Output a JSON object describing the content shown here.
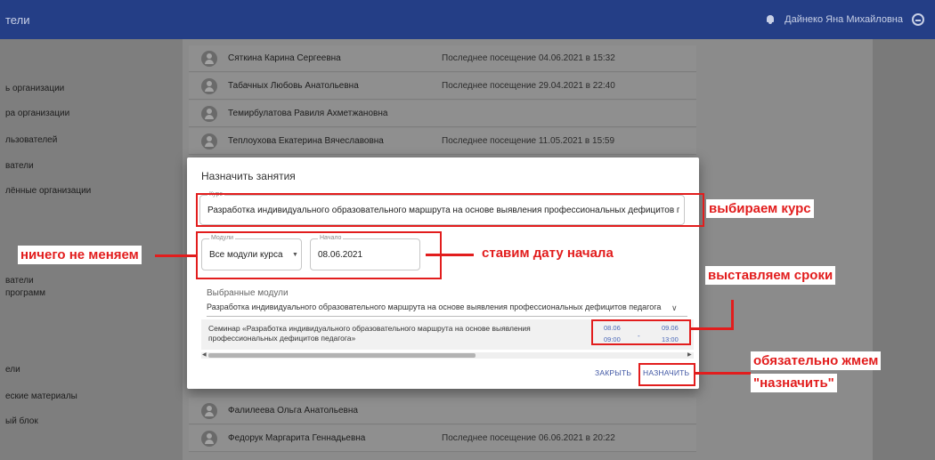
{
  "topbar": {
    "title": "тели",
    "user_name": "Дайнеко Яна Михайловна"
  },
  "sidebar": {
    "items": [
      "ь организации",
      "ра организации",
      "льзователей",
      "ватели",
      "лённые организации",
      "ватели",
      "программ",
      "ели",
      "еские материалы",
      "ый блок"
    ]
  },
  "people": [
    {
      "name": "Сяткина Карина Сергеевна",
      "visit": "Последнее посещение 04.06.2021 в 15:32"
    },
    {
      "name": "Табачных Любовь Анатольевна",
      "visit": "Последнее посещение 29.04.2021 в 22:40"
    },
    {
      "name": "Темирбулатова Равиля Ахметжановна",
      "visit": ""
    },
    {
      "name": "Теплоухова Екатерина Вячеславовна",
      "visit": "Последнее посещение 11.05.2021 в 15:59"
    },
    {
      "name": "Фалилеева Ольга Анатольевна",
      "visit": ""
    },
    {
      "name": "Федорук Маргарита Геннадьевна",
      "visit": "Последнее посещение 06.06.2021 в 20:22"
    }
  ],
  "dialog": {
    "title": "Назначить занятия",
    "course_label": "Курс",
    "course_value": "Разработка индивидуального образовательного маршрута на основе выявления профессиональных дефицитов педагога",
    "modules_label": "Модули",
    "modules_value": "Все модули курса",
    "start_label": "Начало",
    "start_value": "08.06.2021",
    "selected_label": "Выбранные модули",
    "selected_value": "Разработка индивидуального образовательного маршрута на основе выявления профессиональных дефицитов педагога",
    "module_row": {
      "text": "Семинар «Разработка индивидуального образовательного маршрута на основе выявления профессиональных дефицитов педагога»",
      "start_date": "08.06",
      "start_time": "09:00",
      "end_date": "09.06",
      "end_time": "13:00",
      "separator": "-"
    },
    "close_label": "ЗАКРЫТЬ",
    "assign_label": "НАЗНАЧИТЬ"
  },
  "annotations": {
    "course": "выбираем курс",
    "modules": "ничего не меняем",
    "start": "ставим дату начала",
    "dates": "выставляем сроки",
    "assign_line1": "обязательно жмем",
    "assign_line2": "\"назначить\""
  },
  "colors": {
    "topbar": "#243e86",
    "annotation": "#e21d1d",
    "link": "#4057a4"
  }
}
